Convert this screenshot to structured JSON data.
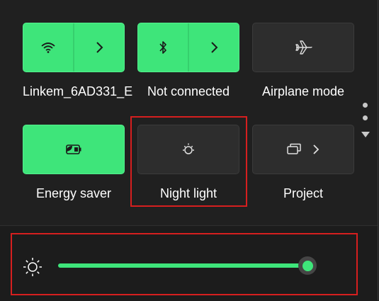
{
  "quick_settings": {
    "tiles": [
      {
        "label": "Linkem_6AD331_E",
        "state": "on",
        "icon": "wifi-icon",
        "has_chevron": true
      },
      {
        "label": "Not connected",
        "state": "on",
        "icon": "bluetooth-icon",
        "has_chevron": true
      },
      {
        "label": "Airplane mode",
        "state": "off",
        "icon": "airplane-icon",
        "has_chevron": false
      },
      {
        "label": "Energy saver",
        "state": "on",
        "icon": "energy-saver-icon",
        "has_chevron": false
      },
      {
        "label": "Night light",
        "state": "off",
        "icon": "night-light-icon",
        "has_chevron": false
      },
      {
        "label": "Project",
        "state": "off",
        "icon": "project-icon",
        "has_chevron": true
      }
    ]
  },
  "brightness": {
    "icon": "brightness-sun-icon",
    "level_fraction": 1.0
  },
  "colors": {
    "accent": "#3ee57a",
    "tile_off": "#2d2d2d",
    "background": "#202020",
    "highlight": "#d61f1f"
  }
}
